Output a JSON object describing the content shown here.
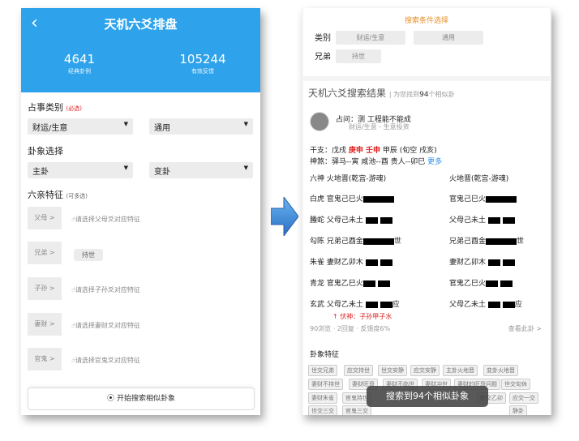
{
  "left": {
    "back_icon": "chevron-left-icon",
    "title": "天机六爻排盘",
    "stats": [
      {
        "num": "4641",
        "label": "经典卦例"
      },
      {
        "num": "105244",
        "label": "有效反馈"
      }
    ],
    "category_label": "占事类别",
    "category_required": "(必选)",
    "category_select1": "财运/生意",
    "category_select2": "通用",
    "gua_label": "卦象选择",
    "gua_select1": "主卦",
    "gua_select2": "变卦",
    "liuqin_label": "六亲特征",
    "liuqin_note": "(可多选)",
    "relatives": [
      {
        "name": "父母 >",
        "hint": "请选择父母爻对应特征"
      },
      {
        "name": "兄弟 >",
        "hint": "",
        "chip": "持世"
      },
      {
        "name": "子孙 >",
        "hint": "请选择子孙爻对应特征"
      },
      {
        "name": "妻财 >",
        "hint": "请选择妻财爻对应特征"
      },
      {
        "name": "官鬼 >",
        "hint": "请选择官鬼爻对应特征"
      }
    ],
    "search_button": "开始搜索相似卦象"
  },
  "right": {
    "cond_title": "搜索条件选择",
    "cond_rows": [
      {
        "label": "类别",
        "chips": [
          "财运/生意",
          "通用"
        ]
      },
      {
        "label": "兄弟",
        "chips": [
          "持世"
        ]
      }
    ],
    "result_title": "天机六爻搜索结果",
    "result_sub_pre": "| 为您找到",
    "result_count": "94",
    "result_sub_post": "个相似卦",
    "question": "占问：测          工程能不能成",
    "question_sub": "财运/生意 - 生意投资",
    "ganzhi_pre": "干支：戊戌 ",
    "ganzhi_red": "庚申 壬申",
    "ganzhi_post": " 甲辰 (旬空 戌亥)",
    "shensha": "神煞：驿马--寅  咸池--酉  贵人--卯巳 ",
    "shensha_more": "更多",
    "left_header": "六神 火地晋(乾宫-游魂)",
    "right_header": "火地晋(乾宫-游魂)",
    "left_yao": [
      "白虎 官鬼己巳火",
      "螣蛇 父母己未土",
      "勾陈 兄弟己酉金",
      "朱雀 妻财乙卯木",
      "青龙 官鬼乙巳火",
      "玄武 父母乙未土"
    ],
    "left_yao_suffix": [
      "",
      "",
      "世",
      "",
      "",
      "应"
    ],
    "right_yao": [
      "官鬼己巳火",
      "父母己未土",
      "兄弟己酉金",
      "妻财乙卯木",
      "官鬼乙巳火",
      "父母乙未土"
    ],
    "right_yao_suffix": [
      "",
      "",
      "世",
      "",
      "",
      "应"
    ],
    "fushen": "↑ 伏神：子孙甲子水",
    "stats": "90浏览 · 2回复 · 反馈度6%",
    "view_link": "查看此卦 >",
    "feature_title": "卦象特征",
    "tags": [
      "世交兄弟",
      "应交持世",
      "世交安静",
      "应交安静",
      "主卦火地晋",
      "变卦火地晋",
      "妻财不持世",
      "妻财旺衰",
      "妻财不临世",
      "妻财冲世",
      "妻财的旺衰问题",
      "世交旬休",
      "妻财朱雀",
      "官鬼持世",
      "",
      "",
      "",
      "应交乙卯",
      "应交一交",
      "静卦",
      "世交三交",
      "官鬼三交",
      "",
      "",
      "",
      "",
      ""
    ],
    "toast": "搜索到94个相似卦象"
  }
}
